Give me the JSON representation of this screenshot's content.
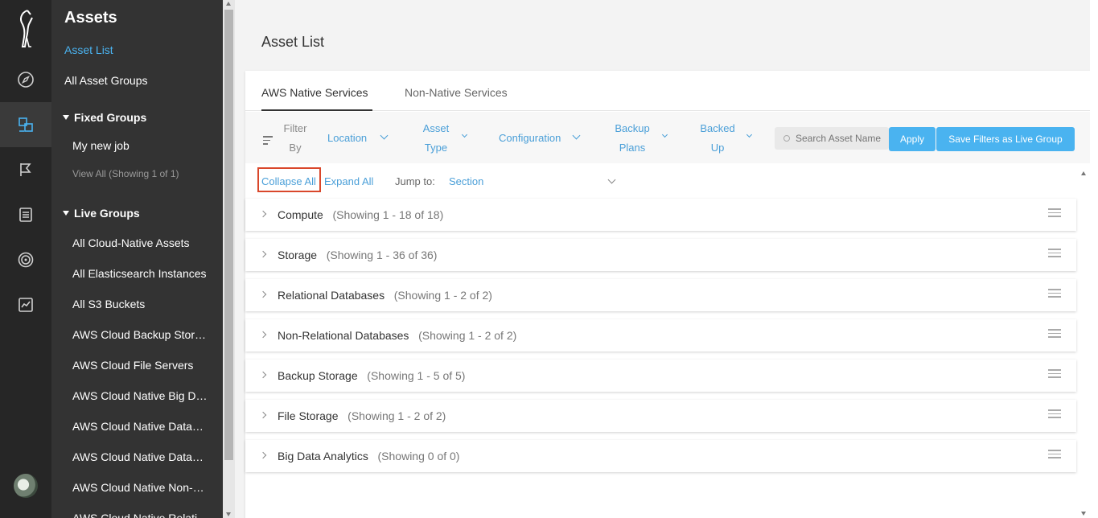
{
  "nav": {
    "title": "Assets",
    "asset_list": "Asset List",
    "all_asset_groups": "All Asset Groups",
    "fixed_groups": {
      "title": "Fixed Groups",
      "items": [
        "My new job"
      ],
      "view_all": "View All (Showing 1 of 1)"
    },
    "live_groups": {
      "title": "Live Groups",
      "items": [
        "All Cloud-Native Assets",
        "All Elasticsearch Instances",
        "All S3 Buckets",
        "AWS Cloud Backup Storage",
        "AWS Cloud File Servers",
        "AWS Cloud Native Big Data",
        "AWS Cloud Native Databases",
        "AWS Cloud Native Databases",
        "AWS Cloud Native Non-Relational",
        "AWS Cloud Native Relational"
      ]
    }
  },
  "page": {
    "title": "Asset List",
    "tabs": [
      "AWS Native Services",
      "Non-Native Services"
    ]
  },
  "filters": {
    "label_line1": "Filter",
    "label_line2": "By",
    "location": "Location",
    "asset_type_line1": "Asset",
    "asset_type_line2": "Type",
    "configuration": "Configuration",
    "backup_plans_line1": "Backup",
    "backup_plans_line2": "Plans",
    "backed_up_line1": "Backed",
    "backed_up_line2": "Up",
    "search_placeholder": "Search Asset Name",
    "apply": "Apply",
    "save_live_group": "Save Filters as Live Group"
  },
  "tools": {
    "collapse_all": "Collapse All",
    "expand_all": "Expand All",
    "jump_to": "Jump to:",
    "section": "Section"
  },
  "sections": [
    {
      "name": "Compute",
      "count": "(Showing 1 - 18 of 18)"
    },
    {
      "name": "Storage",
      "count": "(Showing 1 - 36 of 36)"
    },
    {
      "name": "Relational Databases",
      "count": "(Showing 1 - 2 of 2)"
    },
    {
      "name": "Non-Relational Databases",
      "count": "(Showing 1 - 2 of 2)"
    },
    {
      "name": "Backup Storage",
      "count": "(Showing 1 - 5 of 5)"
    },
    {
      "name": "File Storage",
      "count": "(Showing 1 - 2 of 2)"
    },
    {
      "name": "Big Data Analytics",
      "count": "(Showing 0 of 0)"
    }
  ],
  "icons": {
    "logo": "bird-logo-icon",
    "rail": [
      "compass-icon",
      "assets-icon",
      "flag-icon",
      "document-icon",
      "target-icon",
      "chart-icon"
    ]
  },
  "colors": {
    "accent": "#4ab3f0",
    "link": "#4a9fd8",
    "rail_bg": "#262626",
    "nav_bg": "#333333",
    "highlight": "#d9472b"
  }
}
